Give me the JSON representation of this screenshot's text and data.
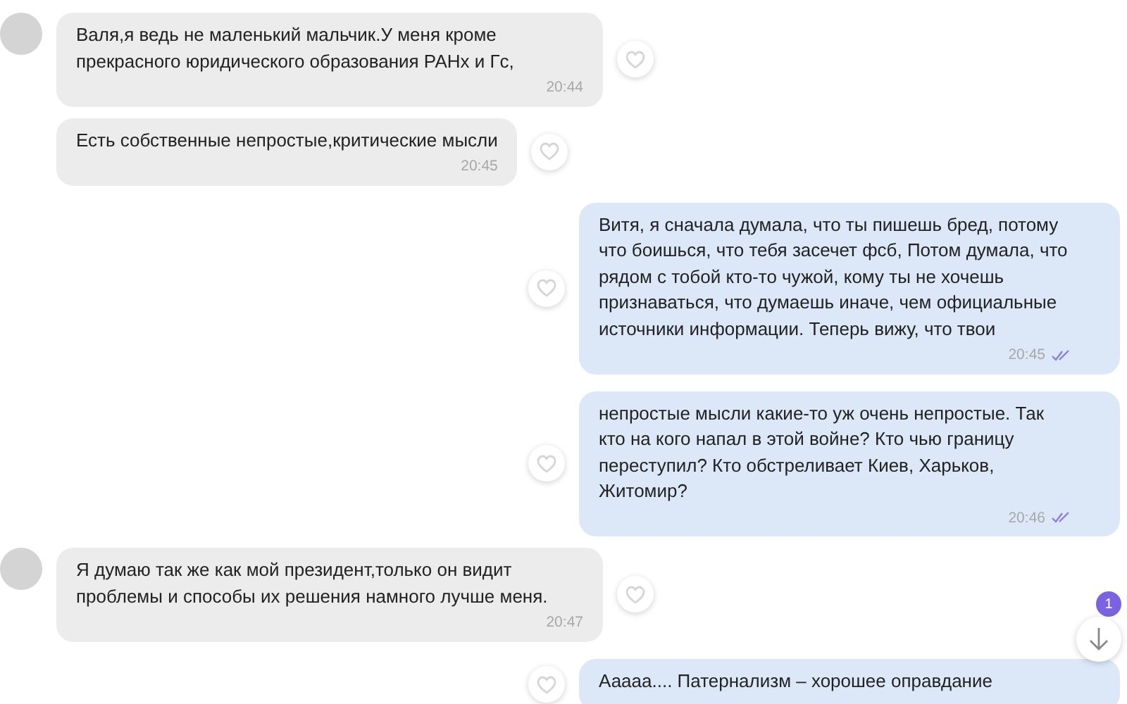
{
  "messages": [
    {
      "kind": "incoming",
      "avatar": true,
      "text": "Валя,я ведь не маленький мальчик.У меня кроме прекрасного юридического образования РАНх и Гс,",
      "time": "20:44"
    },
    {
      "kind": "incoming",
      "avatar": false,
      "text": "Есть собственные непростые,критические мысли",
      "time": "20:45"
    },
    {
      "kind": "outgoing",
      "read": true,
      "text": "Витя, я сначала думала, что ты пишешь бред, потому что боишься, что тебя засечет фсб, Потом думала, что рядом с тобой кто-то чужой, кому ты не хочешь признаваться, что думаешь иначе, чем официальные источники информации. Теперь вижу, что твои",
      "time": "20:45"
    },
    {
      "kind": "outgoing",
      "read": true,
      "text": "непростые мысли какие-то уж очень непростые. Так кто на кого напал в этой войне? Кто чью границу переступил? Кто обстреливает Киев, Харьков, Житомир?",
      "time": "20:46"
    },
    {
      "kind": "incoming",
      "avatar": true,
      "text": "Я думаю так же как мой президент,только он видит проблемы и способы их решения намного лучше меня.",
      "time": "20:47"
    },
    {
      "kind": "outgoing",
      "text": "Ааааа.... Патернализм – хорошее оправдание"
    }
  ],
  "scroll_button": {
    "unread": "1"
  }
}
